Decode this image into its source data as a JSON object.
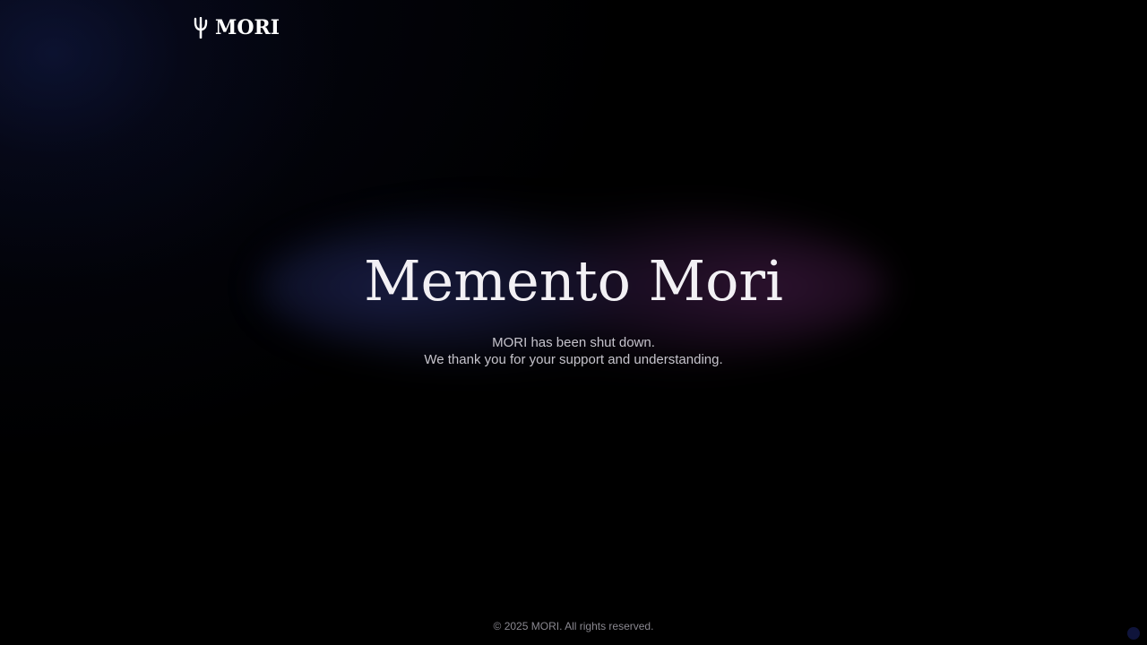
{
  "header": {
    "logo": {
      "icon": "tree-icon",
      "text": "MORI"
    }
  },
  "hero": {
    "title": "Memento Mori",
    "lines": [
      "MORI has been shut down.",
      "We thank you for your support and understanding."
    ]
  },
  "footer": {
    "copyright": "© 2025 MORI. All rights reserved."
  },
  "colors": {
    "background": "#000000",
    "title": "#f2f0f4",
    "subtitle": "#c6c4cc",
    "footer": "#8a8890",
    "glow_left": "#28306e",
    "glow_right": "#501e50"
  }
}
